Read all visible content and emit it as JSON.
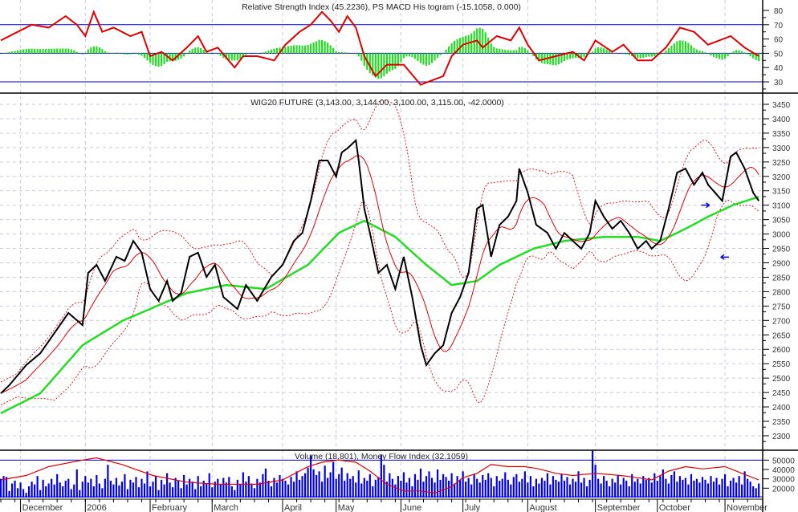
{
  "colors": {
    "price": "#000000",
    "ma_short": "#e00000",
    "ma_long": "#22dd22",
    "bands": "#e00000",
    "rsi": "#e00000",
    "macd": "#22dd22",
    "volume": "#0000ee",
    "mfi": "#e00000",
    "levels": "#0000cc",
    "grid": "#c8c8e0",
    "annot_arrow": "#0000ee"
  },
  "chart_data": [
    {
      "type": "line",
      "panel": "rsi",
      "title": "Relative Strength Index (45.2236), PS MACD His togram (-15.1058, 0.000)",
      "yticks": [
        30,
        40,
        50,
        60,
        70,
        80
      ],
      "ylim": [
        25,
        87
      ],
      "levels": [
        30,
        50,
        70
      ],
      "rsi": {
        "d": [
          0,
          6,
          11,
          17,
          23,
          27,
          30,
          33,
          36,
          40,
          46,
          50,
          53,
          57,
          61,
          66,
          70,
          73,
          77,
          83,
          86,
          91,
          97,
          101,
          106,
          110,
          114,
          117,
          120,
          123,
          126,
          129,
          133,
          137,
          143,
          149,
          153,
          157,
          160,
          164,
          169,
          171,
          176,
          181,
          184,
          187,
          191,
          197,
          203,
          207,
          211,
          217,
          221,
          226,
          231,
          236,
          241,
          246,
          251,
          259,
          264,
          269
        ],
        "v": [
          59,
          65,
          70,
          68,
          76,
          70,
          62,
          79,
          65,
          68,
          62,
          65,
          48,
          51,
          45,
          54,
          62,
          51,
          54,
          40,
          48,
          48,
          45,
          56,
          65,
          70,
          79,
          73,
          65,
          76,
          68,
          48,
          34,
          42,
          42,
          28,
          31,
          34,
          48,
          56,
          59,
          54,
          62,
          59,
          68,
          56,
          45,
          48,
          51,
          45,
          59,
          51,
          56,
          45,
          45,
          54,
          68,
          65,
          56,
          62,
          54,
          48
        ]
      },
      "macd_histogram": "computed from close (12,26,9)"
    },
    {
      "type": "line",
      "panel": "price",
      "title": "WIG20 FUTURE (3,143.00, 3,144.00, 3,100.00, 3,115.00, -42.0000)",
      "yticks": [
        2300,
        2350,
        2400,
        2450,
        2500,
        2550,
        2600,
        2650,
        2700,
        2750,
        2800,
        2850,
        2900,
        2950,
        3000,
        3050,
        3100,
        3150,
        3200,
        3250,
        3300,
        3350,
        3400,
        3450
      ],
      "ylim": [
        2265,
        3485
      ],
      "days": 270,
      "close": {
        "d": [
          0,
          3,
          9,
          14,
          20,
          24,
          29,
          31,
          34,
          37,
          41,
          44,
          47,
          50,
          53,
          56,
          59,
          61,
          64,
          67,
          70,
          73,
          76,
          79,
          84,
          87,
          91,
          96,
          100,
          104,
          107,
          110,
          113,
          116,
          119,
          121,
          123,
          126,
          127,
          129,
          131,
          134,
          137,
          140,
          143,
          146,
          149,
          151,
          154,
          157,
          160,
          163,
          166,
          169,
          171,
          174,
          177,
          180,
          183,
          184,
          187,
          190,
          194,
          197,
          200,
          203,
          206,
          209,
          211,
          214,
          217,
          220,
          223,
          226,
          229,
          231,
          234,
          237,
          240,
          243,
          246,
          249,
          251,
          256,
          259,
          261,
          264,
          267,
          269
        ],
        "v": [
          2447,
          2475,
          2545,
          2586,
          2670,
          2726,
          2684,
          2865,
          2893,
          2837,
          2921,
          2907,
          2976,
          2935,
          2809,
          2768,
          2837,
          2768,
          2795,
          2921,
          2935,
          2851,
          2893,
          2781,
          2740,
          2823,
          2768,
          2851,
          2893,
          2976,
          3004,
          3115,
          3255,
          3255,
          3199,
          3283,
          3297,
          3325,
          3255,
          3088,
          3004,
          2865,
          2893,
          2809,
          2921,
          2781,
          2614,
          2545,
          2586,
          2614,
          2726,
          2781,
          2865,
          3088,
          3101,
          2921,
          3032,
          3060,
          3115,
          3227,
          3143,
          3032,
          3004,
          2949,
          3004,
          2976,
          2949,
          3004,
          3115,
          3060,
          3018,
          3046,
          3004,
          2949,
          2976,
          2949,
          2976,
          3088,
          3213,
          3227,
          3171,
          3213,
          3171,
          3115,
          3269,
          3283,
          3227,
          3143,
          3115
        ]
      },
      "ma_long": {
        "d": [
          0,
          14,
          29,
          43,
          53,
          66,
          80,
          94,
          109,
          120,
          129,
          140,
          151,
          160,
          169,
          177,
          189,
          200,
          214,
          226,
          234,
          243,
          251,
          260,
          269
        ],
        "v": [
          2378,
          2447,
          2614,
          2698,
          2740,
          2795,
          2823,
          2809,
          2893,
          3004,
          3046,
          2990,
          2893,
          2823,
          2837,
          2893,
          2949,
          2976,
          2990,
          2990,
          2976,
          3018,
          3060,
          3101,
          3129
        ]
      },
      "ma_short_period": 10,
      "bands_period": 20,
      "bands_k": 2,
      "annotations": [
        {
          "type": "arrow-right",
          "d": 250,
          "v": 3100
        },
        {
          "type": "arrow-left",
          "d": 257,
          "v": 2920
        }
      ]
    },
    {
      "type": "bar",
      "panel": "volume",
      "title": "Volume (18,801), Money Flow Index (32.1059)",
      "yticks": [
        20000,
        30000,
        40000,
        50000
      ],
      "volume_thousands": [
        30,
        33,
        32,
        17,
        25,
        28,
        20,
        26,
        19,
        15,
        22,
        27,
        24,
        33,
        18,
        29,
        22,
        25,
        30,
        24,
        35,
        26,
        22,
        28,
        30,
        19,
        24,
        40,
        18,
        27,
        33,
        26,
        30,
        22,
        34,
        25,
        20,
        30,
        45,
        28,
        24,
        31,
        23,
        27,
        35,
        19,
        29,
        26,
        32,
        21,
        30,
        25,
        38,
        22,
        27,
        33,
        18,
        29,
        24,
        36,
        26,
        21,
        31,
        28,
        20,
        34,
        24,
        30,
        27,
        19,
        33,
        22,
        28,
        25,
        36,
        21,
        27,
        30,
        24,
        31,
        26,
        32,
        22,
        18,
        29,
        24,
        37,
        27,
        33,
        25,
        20,
        30,
        26,
        35,
        41,
        28,
        22,
        31,
        26,
        34,
        30,
        28,
        24,
        32,
        27,
        38,
        29,
        33,
        36,
        42,
        55,
        40,
        34,
        38,
        27,
        44,
        31,
        37,
        48,
        30,
        35,
        42,
        28,
        36,
        30,
        33,
        26,
        39,
        25,
        31,
        28,
        35,
        22,
        29,
        32,
        56,
        45,
        27,
        36,
        30,
        24,
        33,
        28,
        37,
        26,
        31,
        22,
        35,
        29,
        41,
        27,
        33,
        38,
        31,
        26,
        40,
        29,
        35,
        32,
        28,
        36,
        25,
        33,
        29,
        38,
        27,
        31,
        24,
        35,
        30,
        26,
        34,
        29,
        36,
        31,
        22,
        33,
        28,
        30,
        37,
        29,
        24,
        32,
        35,
        27,
        30,
        38,
        26,
        33,
        22,
        30,
        25,
        31,
        28,
        36,
        24,
        33,
        29,
        27,
        35,
        28,
        32,
        24,
        30,
        27,
        38,
        26,
        31,
        22,
        29,
        60,
        45,
        30,
        25,
        33,
        28,
        22,
        30,
        26,
        34,
        24,
        31,
        28,
        22,
        35,
        27,
        30,
        25,
        33,
        29,
        31,
        26,
        36,
        28,
        33,
        40,
        30,
        25,
        34,
        38,
        27,
        33,
        29,
        31,
        24,
        35,
        28,
        30,
        26,
        32,
        29,
        25,
        33,
        27,
        31,
        24,
        30,
        35,
        22,
        28,
        31,
        26,
        33,
        24,
        38,
        30,
        27,
        22,
        20,
        25
      ],
      "mfi": {
        "d": [
          0,
          9,
          17,
          29,
          34,
          43,
          54,
          66,
          77,
          91,
          100,
          109,
          114,
          120,
          126,
          131,
          137,
          143,
          149,
          154,
          160,
          164,
          169,
          174,
          180,
          186,
          191,
          197,
          203,
          211,
          220,
          226,
          231,
          237,
          243,
          249,
          257,
          263,
          269
        ],
        "v": [
          40,
          50,
          70,
          85,
          90,
          75,
          50,
          35,
          30,
          30,
          40,
          70,
          80,
          85,
          80,
          60,
          30,
          15,
          15,
          10,
          25,
          45,
          55,
          75,
          70,
          70,
          65,
          55,
          50,
          55,
          50,
          45,
          40,
          60,
          70,
          65,
          70,
          55,
          40
        ]
      }
    }
  ],
  "x_axis": {
    "months": [
      {
        "label": "December",
        "d": 7
      },
      {
        "label": "2006",
        "d": 30
      },
      {
        "label": "February",
        "d": 53
      },
      {
        "label": "March",
        "d": 75
      },
      {
        "label": "April",
        "d": 100
      },
      {
        "label": "May",
        "d": 119
      },
      {
        "label": "June",
        "d": 142
      },
      {
        "label": "July",
        "d": 164
      },
      {
        "label": "August",
        "d": 187
      },
      {
        "label": "September",
        "d": 211
      },
      {
        "label": "October",
        "d": 233
      },
      {
        "label": "November",
        "d": 257
      }
    ]
  }
}
